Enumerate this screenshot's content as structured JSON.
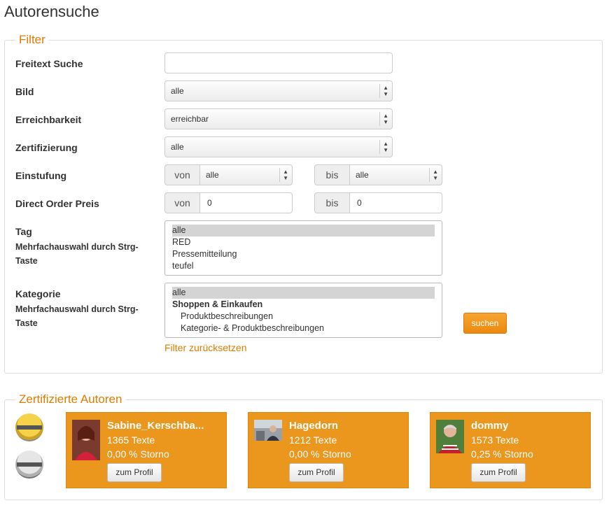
{
  "page_title": "Autorensuche",
  "filter": {
    "legend": "Filter",
    "freitext": {
      "label": "Freitext Suche",
      "value": ""
    },
    "bild": {
      "label": "Bild",
      "value": "alle"
    },
    "erreichbarkeit": {
      "label": "Erreichbarkeit",
      "value": "erreichbar"
    },
    "zertifizierung": {
      "label": "Zertifizierung",
      "value": "alle"
    },
    "einstufung": {
      "label": "Einstufung",
      "von_label": "von",
      "von_value": "alle",
      "bis_label": "bis",
      "bis_value": "alle"
    },
    "preis": {
      "label": "Direct Order Preis",
      "von_label": "von",
      "von_value": "0",
      "bis_label": "bis",
      "bis_value": "0"
    },
    "tag": {
      "label": "Tag",
      "hint": "Mehrfachauswahl durch Strg-Taste",
      "options": [
        "alle",
        "RED",
        "Pressemitteilung",
        "teufel"
      ]
    },
    "kategorie": {
      "label": "Kategorie",
      "hint": "Mehrfachauswahl durch Strg-Taste",
      "options": [
        "alle",
        "Shoppen & Einkaufen",
        "Produktbeschreibungen",
        "Kategorie- & Produktbeschreibungen"
      ]
    },
    "search_button": "suchen",
    "reset_link": "Filter zurücksetzen"
  },
  "certified": {
    "legend": "Zertifizierte Autoren",
    "badges": [
      "gold-certification-badge-icon",
      "silver-author-badge-icon"
    ],
    "authors": [
      {
        "name": "Sabine_Kerschba...",
        "texts": "1365 Texte",
        "storno": "0,00 % Storno",
        "button": "zum Profil"
      },
      {
        "name": "Hagedorn",
        "texts": "1212 Texte",
        "storno": "0,00 % Storno",
        "button": "zum Profil"
      },
      {
        "name": "dommy",
        "texts": "1573 Texte",
        "storno": "0,25 % Storno",
        "button": "zum Profil"
      }
    ]
  },
  "colors": {
    "accent": "#e07b00",
    "card": "#eb961d"
  }
}
